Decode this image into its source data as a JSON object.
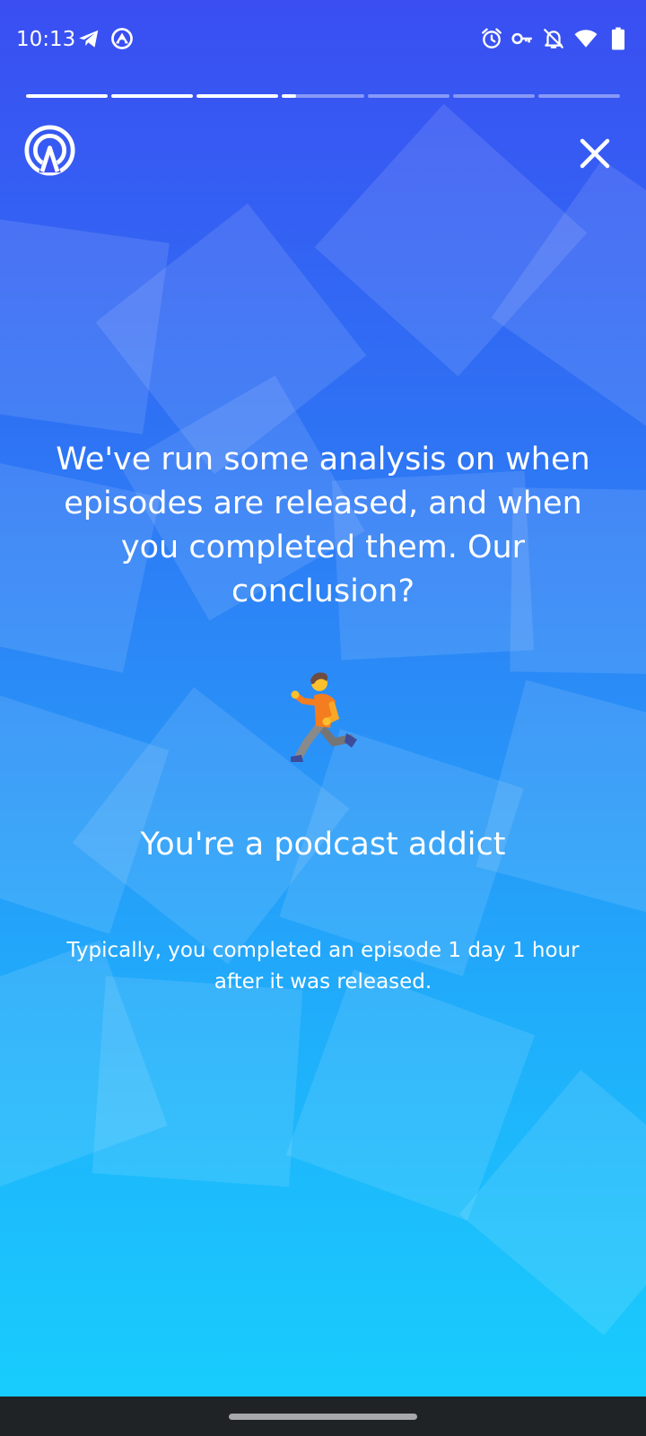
{
  "status_bar": {
    "time": "10:13",
    "left_icons": [
      "telegram-icon",
      "app-notification-icon"
    ],
    "right_icons": [
      "alarm-icon",
      "vpn-key-icon",
      "notifications-off-icon",
      "wifi-icon",
      "battery-icon"
    ]
  },
  "story": {
    "segments_total": 7,
    "segments_complete": 3,
    "current_segment_progress": 0.17,
    "logo_icon": "podcast-app-logo-icon",
    "close_icon": "close-icon",
    "headline": "We've run some analysis on when episodes are released, and when you completed them. Our conclusion?",
    "emoji_icon": "person-running-icon",
    "subheadline": "You're a podcast addict",
    "detail": "Typically, you completed an episode 1 day 1 hour after it was released."
  },
  "colors": {
    "gradient_top": "#3a4ef2",
    "gradient_bottom": "#18cdfd",
    "nav_bar": "#202326"
  }
}
